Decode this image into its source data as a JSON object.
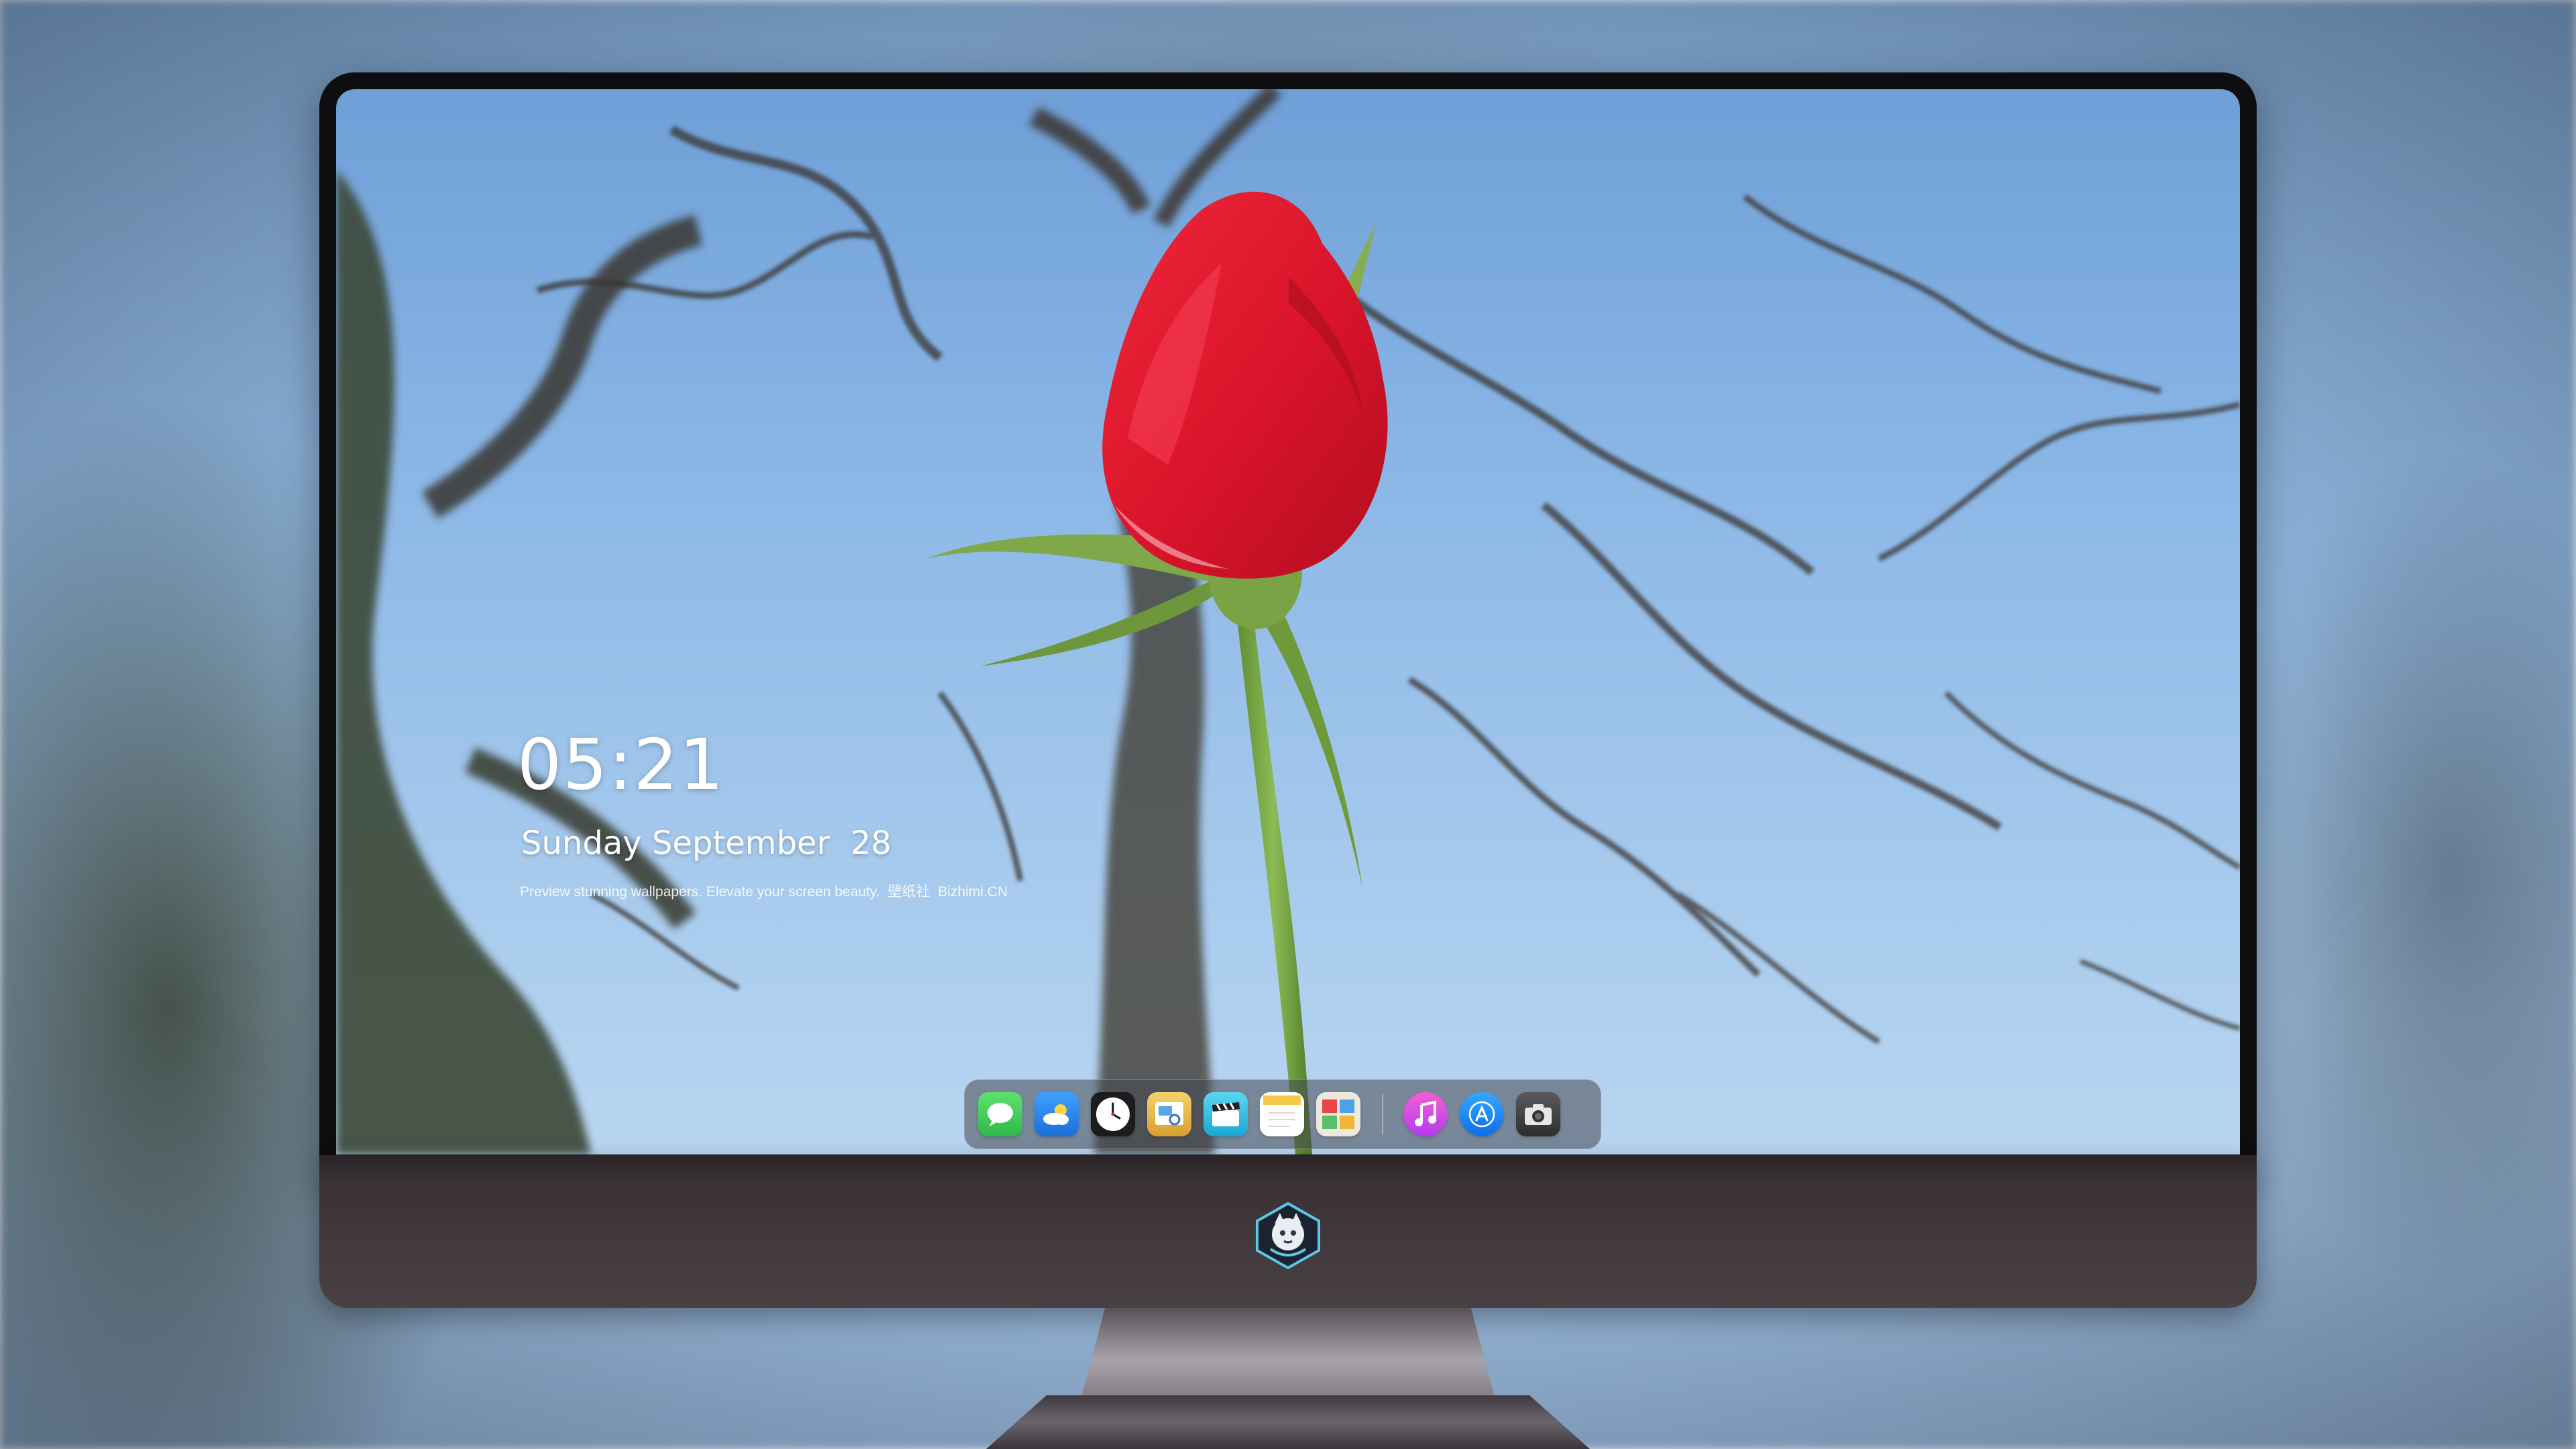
{
  "lock_screen": {
    "time": "05:21",
    "date": "Sunday September  28",
    "tagline": {
      "text": "Preview stunning wallpapers. Elevate your screen beauty.",
      "brand_cn": "壁纸社",
      "site": "Bizhimi.CN"
    }
  },
  "dock": {
    "apps": [
      {
        "name": "messages-icon",
        "color": "#34c759"
      },
      {
        "name": "weather-icon",
        "color": "#2d8cf0"
      },
      {
        "name": "clock-icon",
        "color": "#1c1c1e"
      },
      {
        "name": "preview-icon",
        "color": "#e6b84a"
      },
      {
        "name": "clapper-icon",
        "color": "#3cc6e8"
      },
      {
        "name": "notes-icon",
        "color": "#f7c948"
      },
      {
        "name": "photo-booth-icon",
        "color": "#e8e4d8"
      }
    ],
    "pinned": [
      {
        "name": "music-icon",
        "color": "#e444c6"
      },
      {
        "name": "app-store-icon",
        "color": "#1e88ff"
      },
      {
        "name": "camera-icon",
        "color": "#3a3a3c"
      }
    ]
  },
  "colors": {
    "sky_top": "#6e9fd6",
    "sky_bottom": "#b8d6f1",
    "rose": "#e01b2c",
    "stem": "#6a9a3a",
    "monitor_chin": "#3a3236"
  }
}
